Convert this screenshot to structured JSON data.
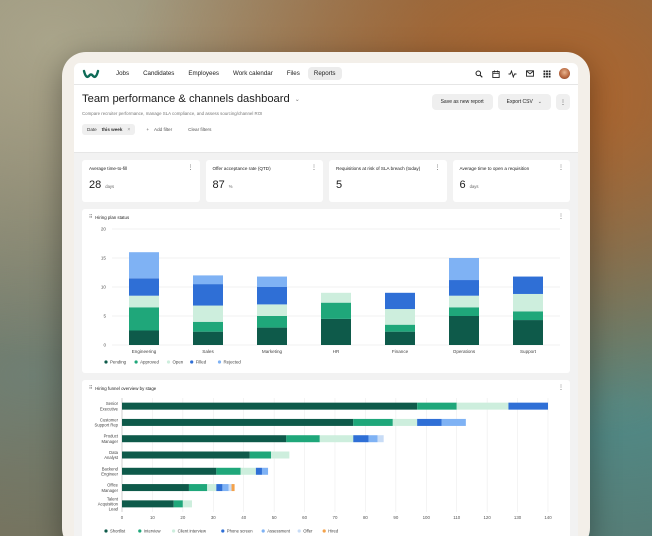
{
  "nav": {
    "links": [
      "Jobs",
      "Candidates",
      "Employees",
      "Work calendar",
      "Files",
      "Reports"
    ],
    "active": "Reports",
    "icons": [
      "search-icon",
      "calendar-icon",
      "activity-icon",
      "mail-icon",
      "grid-icon"
    ]
  },
  "header": {
    "title": "Team performance & channels dashboard",
    "subtitle": "Compare recruiter performance, manage SLA compliance, and assess sourcing/channel ROI",
    "save_label": "Save as new report",
    "export_label": "Export CSV"
  },
  "filters": {
    "date_label": "Date",
    "date_value": "this week",
    "add_filter": "Add filter",
    "clear_filters": "Clear filters"
  },
  "kpis": [
    {
      "label": "Average time-to-fill",
      "value": "28",
      "unit": "days"
    },
    {
      "label": "Offer acceptance rate (QTD)",
      "value": "87",
      "unit": "%"
    },
    {
      "label": "Requisitions at risk of SLA breach (today)",
      "value": "5",
      "unit": ""
    },
    {
      "label": "Average time to open a requisition",
      "value": "6",
      "unit": "days"
    }
  ],
  "colors": {
    "dark_green": "#0e5a4a",
    "green": "#1fa77a",
    "mint": "#cdeedd",
    "blue": "#2f6fd6",
    "light_blue": "#7fb2f4",
    "orange": "#f4a24a",
    "pale_mint": "#a8e2c4"
  },
  "chart_data": [
    {
      "type": "bar",
      "stacked": true,
      "title": "Hiring plan status",
      "categories": [
        "Engineering",
        "Sales",
        "Marketing",
        "HR",
        "Finance",
        "Operations",
        "Support"
      ],
      "series": [
        {
          "name": "Pending",
          "color": "#0e5a4a",
          "values": [
            2.5,
            2.3,
            3.0,
            4.5,
            2.3,
            5.0,
            4.3
          ]
        },
        {
          "name": "Approved",
          "color": "#1fa77a",
          "values": [
            4.0,
            1.7,
            2.0,
            2.8,
            1.2,
            1.5,
            1.5
          ]
        },
        {
          "name": "Open",
          "color": "#cdeedd",
          "values": [
            2.0,
            2.8,
            2.0,
            1.7,
            2.7,
            2.0,
            3.0
          ]
        },
        {
          "name": "Filled",
          "color": "#2f6fd6",
          "values": [
            3.0,
            3.7,
            3.0,
            0.0,
            2.8,
            2.7,
            3.0
          ]
        },
        {
          "name": "Rejected",
          "color": "#7fb2f4",
          "values": [
            4.5,
            1.5,
            1.8,
            0.0,
            0.0,
            3.8,
            0.0
          ]
        }
      ],
      "ylim": [
        0,
        20
      ],
      "yticks": [
        0,
        5,
        10,
        15,
        20
      ],
      "legend": "bottom-left",
      "grid": true
    },
    {
      "type": "bar",
      "orientation": "horizontal",
      "stacked": true,
      "title": "Hiring funnel overview by stage",
      "categories": [
        "Senior Executive",
        "Customer Support Rep",
        "Product Manager",
        "Data Analyst",
        "Backend Engineer",
        "Office Manager",
        "Talent Acquisition Lead"
      ],
      "category_lines": [
        [
          "Senior",
          "Executive"
        ],
        [
          "Customer",
          "Support Rep"
        ],
        [
          "Product",
          "Manager"
        ],
        [
          "Data",
          "Analyst"
        ],
        [
          "Backend",
          "Engineer"
        ],
        [
          "Office",
          "Manager"
        ],
        [
          "Talent",
          "Acquisition",
          "Lead"
        ]
      ],
      "series": [
        {
          "name": "Shortlist",
          "color": "#0e5a4a",
          "values": [
            97,
            76,
            54,
            42,
            31,
            22,
            17
          ]
        },
        {
          "name": "Interview",
          "color": "#1fa77a",
          "values": [
            13,
            13,
            11,
            7,
            8,
            6,
            3
          ]
        },
        {
          "name": "Client interview",
          "color": "#cdeedd",
          "values": [
            17,
            8,
            11,
            6,
            5,
            3,
            3
          ]
        },
        {
          "name": "Phone screen",
          "color": "#2f6fd6",
          "values": [
            13,
            8,
            5,
            0,
            2,
            2,
            0
          ]
        },
        {
          "name": "Assessment",
          "color": "#7fb2f4",
          "values": [
            0,
            8,
            3,
            0,
            2,
            2,
            0
          ]
        },
        {
          "name": "Offer",
          "color": "#c8dcf6",
          "values": [
            0,
            0,
            2,
            0,
            0,
            1,
            0
          ]
        },
        {
          "name": "Hired",
          "color": "#f4a24a",
          "values": [
            0,
            0,
            0,
            0,
            0,
            1,
            0
          ]
        }
      ],
      "xlim": [
        0,
        140
      ],
      "xticks": [
        0,
        10,
        20,
        30,
        40,
        50,
        60,
        70,
        80,
        90,
        100,
        110,
        120,
        130,
        140
      ],
      "legend": "bottom-left",
      "grid": true
    }
  ]
}
